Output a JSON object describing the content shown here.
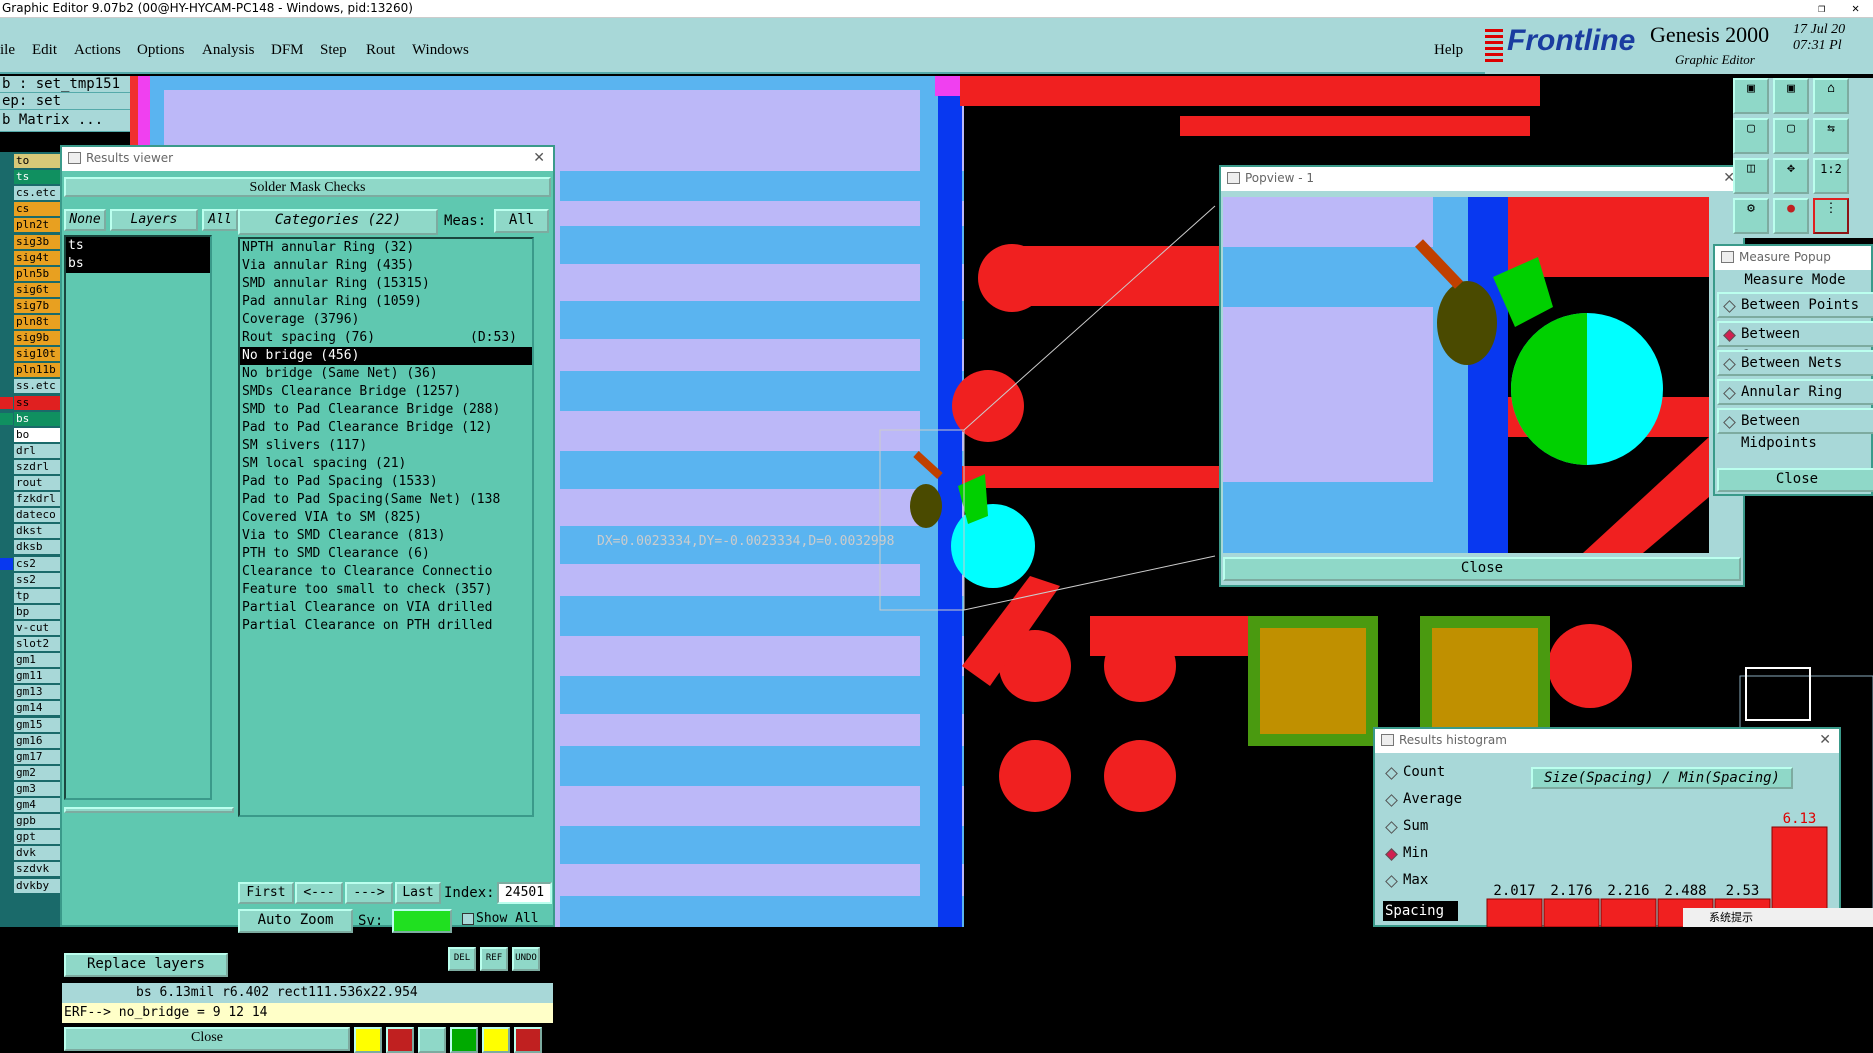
{
  "window": {
    "title": "Graphic Editor 9.07b2 (00@HY-HYCAM-PC148 - Windows, pid:13260)"
  },
  "menu": [
    "ile",
    "Edit",
    "Actions",
    "Options",
    "Analysis",
    "DFM",
    "Step",
    "Rout",
    "Windows"
  ],
  "help": "Help",
  "logo": {
    "brand": "Frontline",
    "product": "Genesis 2000",
    "sub": "Graphic Editor",
    "date": "17 Jul 20",
    "time": "07:31 Pl"
  },
  "left_info": {
    "job": "b : set_tmp151",
    "step": "ep: set",
    "matrix": "b Matrix ..."
  },
  "layers": [
    {
      "name": "to",
      "color": "#d8c878"
    },
    {
      "name": "ts",
      "color": "#109060"
    },
    {
      "name": "cs.etc",
      "color": "#a8d8d8"
    },
    {
      "name": "cs",
      "color": "#e8a020"
    },
    {
      "name": "pln2t",
      "color": "#e8a020"
    },
    {
      "name": "sig3b",
      "color": "#e8a020"
    },
    {
      "name": "sig4t",
      "color": "#e8a020"
    },
    {
      "name": "pln5b",
      "color": "#e8a020"
    },
    {
      "name": "sig6t",
      "color": "#e8a020"
    },
    {
      "name": "sig7b",
      "color": "#e8a020"
    },
    {
      "name": "pln8t",
      "color": "#e8a020"
    },
    {
      "name": "sig9b",
      "color": "#e8a020"
    },
    {
      "name": "sig10t",
      "color": "#e8a020"
    },
    {
      "name": "pln11b",
      "color": "#e8a020"
    },
    {
      "name": "ss.etc",
      "color": "#a8d8d8"
    },
    {
      "name": "ss",
      "color": "#e02020"
    },
    {
      "name": "bs",
      "color": "#109060"
    },
    {
      "name": "bo",
      "color": "#ffffff"
    },
    {
      "name": "drl",
      "color": "#a8d8d8"
    },
    {
      "name": "szdrl",
      "color": "#a8d8d8"
    },
    {
      "name": "rout",
      "color": "#a8d8d8"
    },
    {
      "name": "fzkdrl",
      "color": "#a8d8d8"
    },
    {
      "name": "dateco",
      "color": "#a8d8d8"
    },
    {
      "name": "dkst",
      "color": "#a8d8d8"
    },
    {
      "name": "dksb",
      "color": "#a8d8d8"
    },
    {
      "name": "cs2",
      "color": "#a8d8d8"
    },
    {
      "name": "ss2",
      "color": "#a8d8d8"
    },
    {
      "name": "tp",
      "color": "#a8d8d8"
    },
    {
      "name": "bp",
      "color": "#a8d8d8"
    },
    {
      "name": "v-cut",
      "color": "#a8d8d8"
    },
    {
      "name": "slot2",
      "color": "#a8d8d8"
    },
    {
      "name": "gm1",
      "color": "#a8d8d8"
    },
    {
      "name": "gm11",
      "color": "#a8d8d8"
    },
    {
      "name": "gm13",
      "color": "#a8d8d8"
    },
    {
      "name": "gm14",
      "color": "#a8d8d8"
    },
    {
      "name": "gm15",
      "color": "#a8d8d8"
    },
    {
      "name": "gm16",
      "color": "#a8d8d8"
    },
    {
      "name": "gm17",
      "color": "#a8d8d8"
    },
    {
      "name": "gm2",
      "color": "#a8d8d8"
    },
    {
      "name": "gm3",
      "color": "#a8d8d8"
    },
    {
      "name": "gm4",
      "color": "#a8d8d8"
    },
    {
      "name": "gpb",
      "color": "#a8d8d8"
    },
    {
      "name": "gpt",
      "color": "#a8d8d8"
    },
    {
      "name": "dvk",
      "color": "#a8d8d8"
    },
    {
      "name": "szdvk",
      "color": "#a8d8d8"
    },
    {
      "name": "dvkby",
      "color": "#a8d8d8"
    }
  ],
  "results_viewer": {
    "title": "Results viewer",
    "header": "Solder Mask Checks",
    "none": "None",
    "layers_btn": "Layers",
    "all": "All",
    "categories": "Categories (22)",
    "meas": "Meas:",
    "meas_value": "All",
    "layer_list": [
      "ts",
      "bs"
    ],
    "items": [
      "NPTH annular Ring (32)",
      "Via annular Ring (435)",
      "SMD annular Ring (15315)",
      "Pad annular Ring (1059)",
      "Coverage (3796)",
      "Rout spacing (76)",
      "No bridge (456)",
      "No bridge (Same Net) (36)",
      "SMDs Clearance Bridge (1257)",
      "SMD to Pad Clearance Bridge (288)",
      "Pad to Pad Clearance Bridge (12)",
      "SM slivers (117)",
      "SM local spacing (21)",
      "Pad to Pad Spacing (1533)",
      "Pad to Pad Spacing(Same Net) (138",
      "Covered VIA to SM (825)",
      "Via to SMD Clearance (813)",
      "PTH to SMD Clearance (6)",
      "Clearance to Clearance Connectio",
      "Feature too small to check (357)",
      "Partial Clearance on VIA drilled",
      "Partial Clearance on PTH drilled"
    ],
    "rout_extra": "(D:53)",
    "first": "First",
    "prev": "<---",
    "next": "--->",
    "last": "Last",
    "index_label": "Index:",
    "index_value": "24501",
    "auto_zoom": "Auto Zoom",
    "sv": "Sv:",
    "show_all": "Show All",
    "replace_layers": "Replace layers",
    "del": "DEL",
    "ref": "REF",
    "undo": "UNDO",
    "status": "bs 6.13mil   r6.402   rect111.536x22.954",
    "erf": "ERF--> no_bridge = 9 12 14",
    "close": "Close"
  },
  "measure_text": "DX=0.0023334,DY=-0.0023334,D=0.0032998",
  "popview": {
    "title": "Popview - 1",
    "close": "Close"
  },
  "measure_popup": {
    "title": "Measure Popup",
    "mode": "Measure Mode",
    "options": [
      "Between Points",
      "Between Contours",
      "Between Nets",
      "Annular Ring",
      "Between Midpoints"
    ],
    "selected": 1,
    "close": "Close"
  },
  "histogram": {
    "title": "Results histogram",
    "options": [
      "Count",
      "Average",
      "Sum",
      "Min",
      "Max"
    ],
    "selected": 3,
    "spacing": "Spacing",
    "chart_title": "Size(Spacing) / Min(Spacing)",
    "bars": [
      {
        "label": "2.017"
      },
      {
        "label": "2.176"
      },
      {
        "label": "2.216"
      },
      {
        "label": "2.488"
      },
      {
        "label": "2.53"
      },
      {
        "label": "6.13"
      }
    ]
  },
  "taskbar_tip": "系统提示"
}
